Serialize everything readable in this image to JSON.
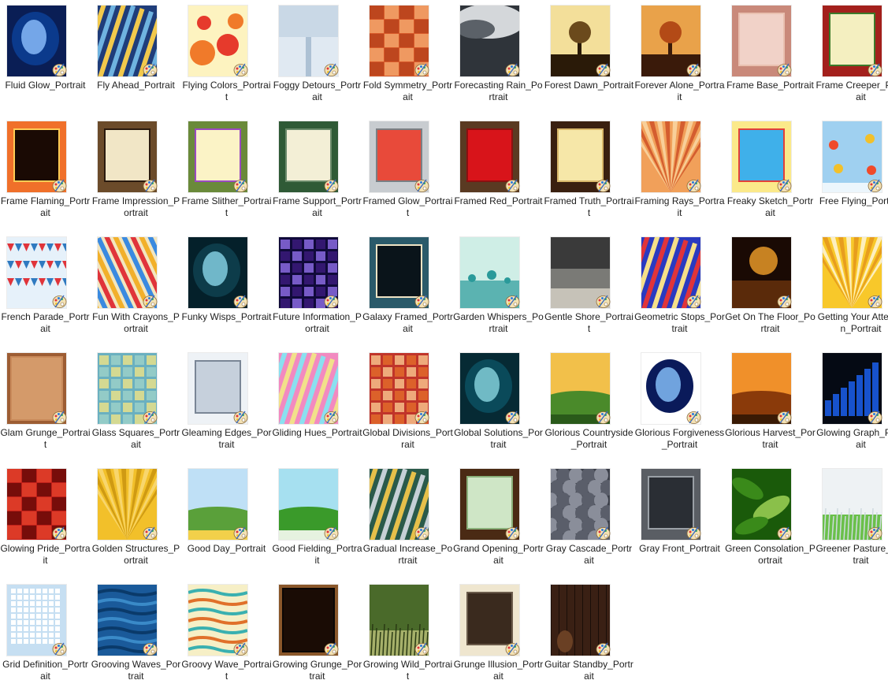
{
  "items": [
    {
      "label": "Fluid Glow_Portrait",
      "icon": "glow-thumbnail",
      "colors": [
        "#0b3a8c",
        "#8fc2ff",
        "#0a1e55"
      ]
    },
    {
      "label": "Fly Ahead_Portrait",
      "icon": "stripes-thumbnail",
      "colors": [
        "#1f3d7a",
        "#f2c94c",
        "#6fb3e0"
      ]
    },
    {
      "label": "Flying Colors_Portrait",
      "icon": "bubbles-thumbnail",
      "colors": [
        "#fdf3c0",
        "#f07a2a",
        "#e63a2c"
      ]
    },
    {
      "label": "Foggy Detours_Portrait",
      "icon": "fog-thumbnail",
      "colors": [
        "#c9d8e6",
        "#e6eef5",
        "#8aa6c0"
      ]
    },
    {
      "label": "Fold Symmetry_Portrait",
      "icon": "checker-thumbnail",
      "colors": [
        "#d85a2a",
        "#f3a46b",
        "#b8431c"
      ]
    },
    {
      "label": "Forecasting Rain_Portrait",
      "icon": "clouds-thumbnail",
      "colors": [
        "#5b6168",
        "#d4d7da",
        "#2f343a"
      ]
    },
    {
      "label": "Forest Dawn_Portrait",
      "icon": "tree-thumbnail",
      "colors": [
        "#f3df9a",
        "#6b4a1c",
        "#2a1a08"
      ]
    },
    {
      "label": "Forever Alone_Portrait",
      "icon": "tree-thumbnail",
      "colors": [
        "#e9a24a",
        "#b34a16",
        "#3a1a0a"
      ]
    },
    {
      "label": "Frame Base_Portrait",
      "icon": "frame-thumbnail",
      "colors": [
        "#f1d2c8",
        "#c9897a",
        "#e9c0b0"
      ]
    },
    {
      "label": "Frame Creeper_Portrait",
      "icon": "frame-thumbnail",
      "colors": [
        "#f4efc0",
        "#a3201c",
        "#3a7a2a"
      ]
    },
    {
      "label": "Frame Flaming_Portrait",
      "icon": "frame-thumbnail",
      "colors": [
        "#1a0a04",
        "#f0702a",
        "#ffcc55"
      ]
    },
    {
      "label": "Frame Impression_Portrait",
      "icon": "frame-thumbnail",
      "colors": [
        "#f1e6c6",
        "#6b4b2a",
        "#2a1a0e"
      ]
    },
    {
      "label": "Frame Slither_Portrait",
      "icon": "frame-thumbnail",
      "colors": [
        "#fbf3c6",
        "#6a8a3a",
        "#9a4ac0"
      ]
    },
    {
      "label": "Frame Support_Portrait",
      "icon": "frame-thumbnail",
      "colors": [
        "#f3efd6",
        "#2f5a36",
        "#6a8a6a"
      ]
    },
    {
      "label": "Framed Glow_Portrait",
      "icon": "frame-thumbnail",
      "colors": [
        "#e84a3a",
        "#c8ccd0",
        "#7a7f84"
      ]
    },
    {
      "label": "Framed Red_Portrait",
      "icon": "frame-thumbnail",
      "colors": [
        "#d8141a",
        "#5a3a22",
        "#8a1010"
      ]
    },
    {
      "label": "Framed Truth_Portrait",
      "icon": "frame-thumbnail",
      "colors": [
        "#f6e7a8",
        "#3a2010",
        "#d9b86a"
      ]
    },
    {
      "label": "Framing Rays_Portrait",
      "icon": "rays-thumbnail",
      "colors": [
        "#f1a05a",
        "#c8401c",
        "#fbe2b4"
      ]
    },
    {
      "label": "Freaky Sketch_Portrait",
      "icon": "frame-thumbnail",
      "colors": [
        "#3fb0ea",
        "#fbe98a",
        "#e2403a"
      ]
    },
    {
      "label": "Free Flying_Portrait",
      "icon": "balloons-thumbnail",
      "colors": [
        "#9fd0f0",
        "#f04a2a",
        "#f2c02a"
      ]
    },
    {
      "label": "French Parade_Portrait",
      "icon": "bunting-thumbnail",
      "colors": [
        "#e6f1fa",
        "#2f7ac0",
        "#e0343a"
      ]
    },
    {
      "label": "Fun With Crayons_Portrait",
      "icon": "crayons-thumbnail",
      "colors": [
        "#e0343a",
        "#f2b02a",
        "#3a8ae0"
      ]
    },
    {
      "label": "Funky Wisps_Portrait",
      "icon": "glow-thumbnail",
      "colors": [
        "#0d3c4a",
        "#8ad6e8",
        "#04202a"
      ]
    },
    {
      "label": "Future Information_Portrait",
      "icon": "squares-thumbnail",
      "colors": [
        "#3a1a7a",
        "#8a6ae0",
        "#100a3a"
      ]
    },
    {
      "label": "Galaxy Framed_Portrait",
      "icon": "frame-thumbnail",
      "colors": [
        "#0a141a",
        "#2a5a6a",
        "#efe4c4"
      ]
    },
    {
      "label": "Garden Whispers_Portrait",
      "icon": "flowers-thumbnail",
      "colors": [
        "#cfeee6",
        "#2a9a9a",
        "#eaf7f2"
      ]
    },
    {
      "label": "Gentle Shore_Portrait",
      "icon": "shore-thumbnail",
      "colors": [
        "#3a3a3a",
        "#c6c2b8",
        "#7a7a76"
      ]
    },
    {
      "label": "Geometric Stops_Portrait",
      "icon": "stripes-thumbnail",
      "colors": [
        "#2a3ac0",
        "#e0343a",
        "#f6e08a"
      ]
    },
    {
      "label": "Get On The Floor_Portrait",
      "icon": "party-thumbnail",
      "colors": [
        "#1a0a04",
        "#f2a02a",
        "#5a2a0a"
      ]
    },
    {
      "label": "Getting Your Attention_Portrait",
      "icon": "rays-thumbnail",
      "colors": [
        "#f8c82a",
        "#ffffff",
        "#e08a1a"
      ]
    },
    {
      "label": "Glam Grunge_Portrait",
      "icon": "grunge-thumbnail",
      "colors": [
        "#c98a5a",
        "#8a4a22",
        "#e8b88a"
      ]
    },
    {
      "label": "Glass Squares_Portrait",
      "icon": "squares-thumbnail",
      "colors": [
        "#9ad0c8",
        "#e6e08a",
        "#6ab0c0"
      ]
    },
    {
      "label": "Gleaming Edges_Portrait",
      "icon": "frame-thumbnail",
      "colors": [
        "#c6d0dc",
        "#eef2f6",
        "#7a8696"
      ]
    },
    {
      "label": "Gliding Hues_Portrait",
      "icon": "stripes-thumbnail",
      "colors": [
        "#f28ac0",
        "#8ae0f0",
        "#f2e08a"
      ]
    },
    {
      "label": "Global Divisions_Portrait",
      "icon": "squares-thumbnail",
      "colors": [
        "#e06a2a",
        "#f6c08a",
        "#c0342a"
      ]
    },
    {
      "label": "Global Solutions_Portrait",
      "icon": "glow-thumbnail",
      "colors": [
        "#0a4a5a",
        "#8ad6e0",
        "#062a34"
      ]
    },
    {
      "label": "Glorious Countryside_Portrait",
      "icon": "landscape-thumbnail",
      "colors": [
        "#f2c04a",
        "#4a8a2a",
        "#2a5a1a"
      ]
    },
    {
      "label": "Glorious Forgiveness_Portrait",
      "icon": "glow-thumbnail",
      "colors": [
        "#0a1a5a",
        "#8ac6ff",
        "#ffffff"
      ]
    },
    {
      "label": "Glorious Harvest_Portrait",
      "icon": "landscape-thumbnail",
      "colors": [
        "#f0902a",
        "#8a3a0a",
        "#3a1a04"
      ]
    },
    {
      "label": "Glowing Graph_Portrait",
      "icon": "bars-thumbnail",
      "colors": [
        "#050a14",
        "#1a5ae0",
        "#0a1a4a"
      ]
    },
    {
      "label": "Glowing Pride_Portrait",
      "icon": "checker-thumbnail",
      "colors": [
        "#c0201a",
        "#6a0a08",
        "#e0402a"
      ]
    },
    {
      "label": "Golden Structures_Portrait",
      "icon": "rays-thumbnail",
      "colors": [
        "#f2c02a",
        "#c08a0a",
        "#fbe08a"
      ]
    },
    {
      "label": "Good Day_Portrait",
      "icon": "landscape-thumbnail",
      "colors": [
        "#bfe0f6",
        "#5aa03a",
        "#f2d04a"
      ]
    },
    {
      "label": "Good Fielding_Portrait",
      "icon": "landscape-thumbnail",
      "colors": [
        "#a6e0f0",
        "#3a9a2a",
        "#e6f2e0"
      ]
    },
    {
      "label": "Gradual Increase_Portrait",
      "icon": "stripes-thumbnail",
      "colors": [
        "#2a5a4a",
        "#e6c04a",
        "#c6d0d6"
      ]
    },
    {
      "label": "Grand Opening_Portrait",
      "icon": "frame-thumbnail",
      "colors": [
        "#cfe6c6",
        "#4a2a14",
        "#8ab07a"
      ]
    },
    {
      "label": "Gray Cascade_Portrait",
      "icon": "scales-thumbnail",
      "colors": [
        "#5a5e6a",
        "#8a8e9a",
        "#3a3e48"
      ]
    },
    {
      "label": "Gray Front_Portrait",
      "icon": "frame-thumbnail",
      "colors": [
        "#2a2e34",
        "#5a5e64",
        "#9aa0a6"
      ]
    },
    {
      "label": "Green Consolation_Portrait",
      "icon": "leaves-thumbnail",
      "colors": [
        "#3a8a1a",
        "#8ac04a",
        "#1a5a0a"
      ]
    },
    {
      "label": "Greener Pasture_Portrait",
      "icon": "grass-thumbnail",
      "colors": [
        "#eef2f4",
        "#6ac04a",
        "#d0dadf"
      ]
    },
    {
      "label": "Grid Definition_Portrait",
      "icon": "grid-thumbnail",
      "colors": [
        "#c6dff2",
        "#ffffff",
        "#8ab6d6"
      ]
    },
    {
      "label": "Grooving Waves_Portrait",
      "icon": "waves-thumbnail",
      "colors": [
        "#1a5a9a",
        "#3a8ac8",
        "#0a3a6a"
      ]
    },
    {
      "label": "Groovy Wave_Portrait",
      "icon": "waves-thumbnail",
      "colors": [
        "#f6efc6",
        "#e0702a",
        "#3ab0b0"
      ]
    },
    {
      "label": "Growing Grunge_Portrait",
      "icon": "grunge-thumbnail",
      "colors": [
        "#0a0604",
        "#c07a3a",
        "#3a1a0a"
      ]
    },
    {
      "label": "Growing Wild_Portrait",
      "icon": "grass-thumbnail",
      "colors": [
        "#4a6a2a",
        "#a6b06a",
        "#2a3a14"
      ]
    },
    {
      "label": "Grunge Illusion_Portrait",
      "icon": "frame-thumbnail",
      "colors": [
        "#3a2a1e",
        "#efe6cf",
        "#6a5a4a"
      ]
    },
    {
      "label": "Guitar Standby_Portrait",
      "icon": "wood-thumbnail",
      "colors": [
        "#3a2014",
        "#6a4024",
        "#1a0e08"
      ]
    }
  ]
}
